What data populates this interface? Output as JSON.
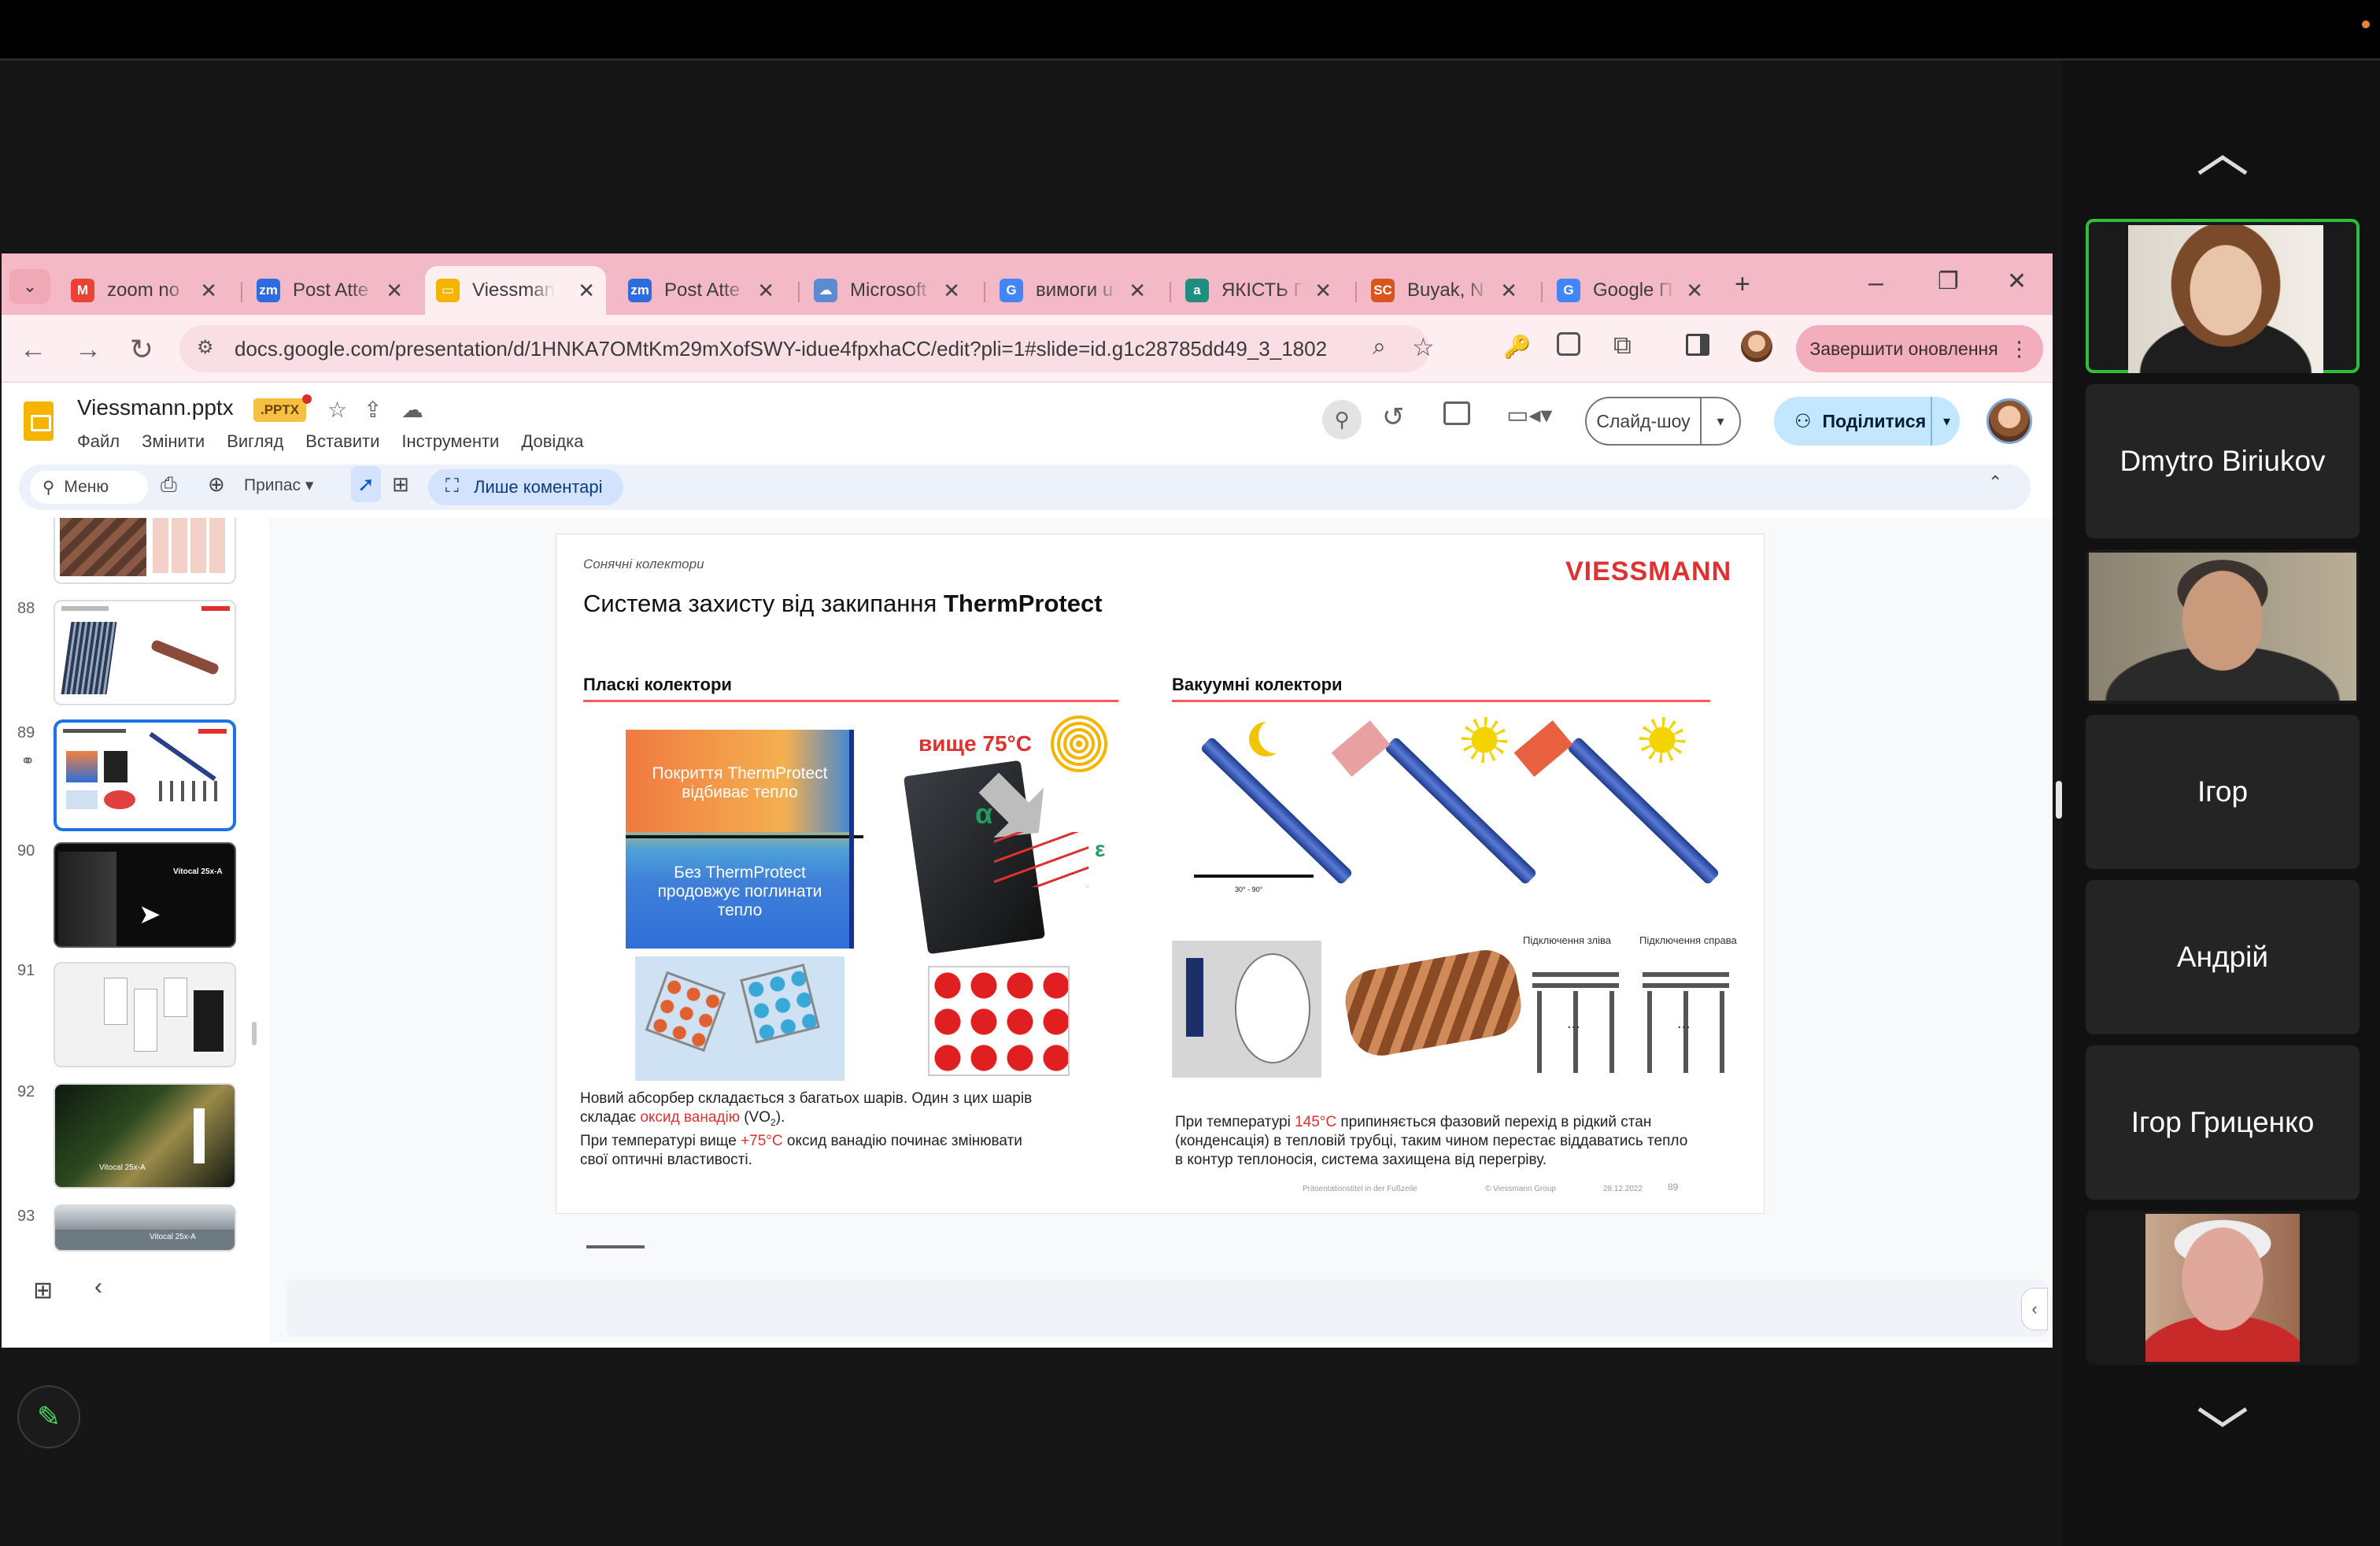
{
  "browser": {
    "tabs": [
      {
        "title": "zoom no",
        "favicon": "gmail-icon",
        "color": "#ea4335",
        "glyph": "M"
      },
      {
        "title": "Post Atte",
        "favicon": "zoom-icon",
        "color": "#2d6cdf",
        "glyph": "zm"
      },
      {
        "title": "Viessman",
        "favicon": "slides-icon",
        "color": "#f4b400",
        "glyph": "▭",
        "active": true
      },
      {
        "title": "Post Atte",
        "favicon": "zoom-icon",
        "color": "#2d6cdf",
        "glyph": "zm"
      },
      {
        "title": "Microsoft",
        "favicon": "onedrive-icon",
        "color": "#5b8bd0",
        "glyph": "☁"
      },
      {
        "title": "вимоги u",
        "favicon": "google-icon",
        "color": "#4285f4",
        "glyph": "G"
      },
      {
        "title": "ЯКІСТЬ П",
        "favicon": "doc-icon",
        "color": "#1e8e7e",
        "glyph": "a"
      },
      {
        "title": "Buyak, N",
        "favicon": "sc-icon",
        "color": "#d9541e",
        "glyph": "SC"
      },
      {
        "title": "Google П",
        "favicon": "google-translate-icon",
        "color": "#4285f4",
        "glyph": "G"
      }
    ],
    "new_tab": "+",
    "window_buttons": {
      "minimize": "–",
      "restore": "❐",
      "close": "✕"
    },
    "url": "docs.google.com/presentation/d/1HNKA7OMtKm29mXofSWY-idue4fpxhaCC/edit?pli=1#slide=id.g1c28785dd49_3_1802",
    "update_button": "Завершити оновлення"
  },
  "slides_app": {
    "doc_title": "Viessmann.pptx",
    "file_badge": ".PPTX",
    "menu": [
      "Файл",
      "Змінити",
      "Вигляд",
      "Вставити",
      "Інструменти",
      "Довідка"
    ],
    "slideshow_button": "Слайд-шоу",
    "share_button": "Поділитися",
    "toolbar": {
      "search_label": "Меню",
      "zoom_label": "Припас",
      "comments_only": "Лише коментарі"
    },
    "filmstrip": [
      {
        "num": "",
        "style": "solar-roof"
      },
      {
        "num": "88",
        "style": "tube-collector"
      },
      {
        "num": "89",
        "style": "thermprotect",
        "selected": true
      },
      {
        "num": "90",
        "style": "dark-product"
      },
      {
        "num": "91",
        "style": "white-units"
      },
      {
        "num": "92",
        "style": "forest-product"
      },
      {
        "num": "93",
        "style": "house-roof"
      }
    ],
    "thumb_texts": {
      "t90": "Vitocal 25x-A",
      "t92": "Vitocal 25x-A",
      "t93": "Vitocal 25x-A"
    }
  },
  "slide": {
    "section": "Сонячні колектори",
    "title": "Система захисту від закипання",
    "title_bold": "ThermProtect",
    "brand": "VIESSMANN",
    "flat": {
      "heading": "Пласкі колектори",
      "thermo_top": "Покриття ThermProtect\nвідбиває тепло",
      "thermo_bottom": "Без ThermProtect\nпродовжує поглинати\nтепло",
      "temp": "вище 75°C",
      "alpha": "α",
      "eps": "ε",
      "desc1_a": "Новий абсорбер складається з багатьох шарів. Один з цих шарів",
      "desc1_b": "складає",
      "desc1_red": "оксид ванадію",
      "desc1_c": "(VO",
      "desc1_sub": "2",
      "desc1_d": ").",
      "desc2_a": "При температурі вище",
      "desc2_red": "+75°C",
      "desc2_b": "оксид ванадію починає змінювати",
      "desc2_c": "свої оптичні властивості."
    },
    "vacuum": {
      "heading": "Вакуумні колектори",
      "angle_label": "30° - 90°",
      "conn_left": "Підключення зліва",
      "conn_right": "Підключення справа",
      "dots": "...",
      "desc_a": "При температурі",
      "desc_red": "145°C",
      "desc_b": "припиняється  фазовий перехід в рідкий стан",
      "desc_c": "(конденсація) в тепловій трубці, таким чином перестає віддаватись тепло",
      "desc_d": "в  контур теплоносія, система захищена від перегріву."
    },
    "footer": {
      "left": "Präsentationstitel in der Fußzeile",
      "mid": "© Viessmann Group",
      "date": "28.12.2022",
      "page": "89"
    }
  },
  "zoom": {
    "participants": [
      {
        "name": "",
        "kind": "video-woman",
        "active": true
      },
      {
        "name": "Dmytro Biriukov",
        "kind": "name"
      },
      {
        "name": "",
        "kind": "video-man"
      },
      {
        "name": "Ігор",
        "kind": "name"
      },
      {
        "name": "Андрій",
        "kind": "name"
      },
      {
        "name": "Ігор Гриценко",
        "kind": "name"
      },
      {
        "name": "",
        "kind": "video-older-man"
      }
    ]
  },
  "colors": {
    "accent": "#1a73e8",
    "tab_strip": "#f3b9c6",
    "viessmann_red": "#e03030",
    "active_speaker": "#2fbd3a"
  }
}
